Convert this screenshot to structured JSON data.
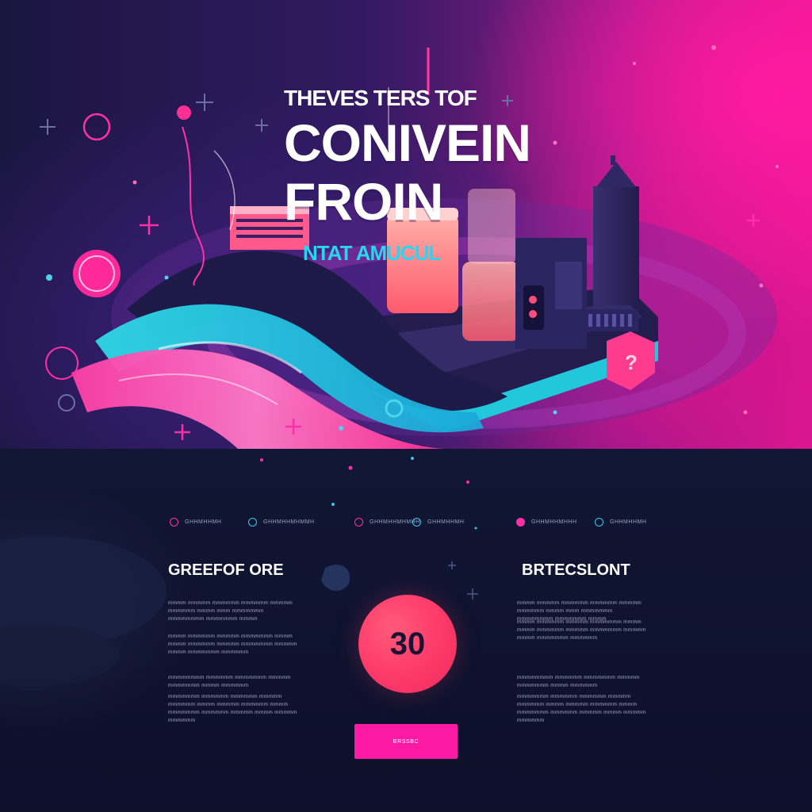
{
  "hero": {
    "kicker": "THEVES TERS TOF",
    "title_line1": "CONIVEIN",
    "title_line2": "FROIN",
    "subtitle": "NTAT AMUCUL"
  },
  "nav": {
    "items": [
      {
        "label": "GHHMHHMH",
        "icon": "circle-icon"
      },
      {
        "label": "GHHMHHMHMMH",
        "icon": "circle-icon"
      },
      {
        "label": "GHHMHHMHMHH",
        "icon": "circle-icon"
      },
      {
        "label": "GHHMHHMH",
        "icon": "circle-icon"
      },
      {
        "label": "GHHMHHMHHH",
        "icon": "circle-icon"
      },
      {
        "label": "GHHMHHMH",
        "icon": "circle-icon"
      }
    ]
  },
  "left_column": {
    "title": "GREEFOF ORE",
    "paragraphs": [
      "mmmm mmmmm mmmmmm mmmmmm mmmmm mmmmmm mmmm mmm mmmmmmm mmmmmmmm mmmmmmm mmmm",
      "mmmm mmmmmm mmmmm mmmmmmm mmmm mmmm mmmmmm mmmmm mmmmmmm mmmmm mmmm mmmmmmm mmmmmm",
      "mmmmmmmm mmmmmm mmmmmmm mmmmm mmmmmmm mmmm mmmmmm",
      "mmmmmmm mmmmmm mmmmmm mmmmm mmmmmm mmmm mmmmm mmmmmm mmmm mmmmmmm mmmmmm mmmmm mmmm mmmmm mmmmmm"
    ]
  },
  "center": {
    "counter_value": "30",
    "cta_label": "BRSSBC"
  },
  "right_column": {
    "title": "BRTECSLONT",
    "paragraphs": [
      "mmmm mmmmm mmmmmm mmmmmm mmmmm mmmmmm mmmm mmm mmmmmmm mmmmmmmm mmmmmmm mmmm",
      "mmmm mmmmmm mmmmm mmmmmmm mmmm mmmm mmmmmm mmmmm mmmmmmm mmmmm mmmm mmmmmmm mmmmmm",
      "mmmmmmmm mmmmmm mmmmmmm mmmmm mmmmmmm mmmm mmmmmm",
      "mmmmmmm mmmmmm mmmmmm mmmmm mmmmmm mmmm mmmmm mmmmmm mmmm mmmmmmm mmmmmm mmmmm mmmm mmmmm mmmmmm"
    ]
  },
  "colors": {
    "accent_pink": "#ff1aa6",
    "accent_cyan": "#27d6f0",
    "counter_coral": "#ff3e6c",
    "background_navy": "#0e1230"
  }
}
